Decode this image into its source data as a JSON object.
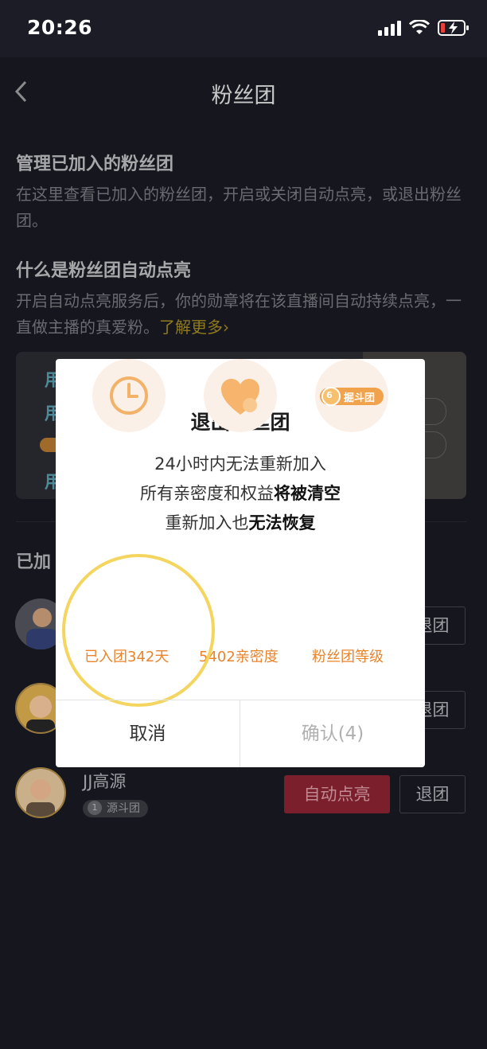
{
  "status_bar": {
    "time": "20:26"
  },
  "nav": {
    "back_icon": "chevron-left-icon",
    "title": "粉丝团"
  },
  "manage": {
    "title": "管理已加入的粉丝团",
    "body": "在这里查看已加入的粉丝团，开启或关闭自动点亮，或退出粉丝团。"
  },
  "auto_light": {
    "title": "什么是粉丝团自动点亮",
    "body": "开启自动点亮服务后，你的勋章将在该直播间自动持续点亮，一直做主播的真爱粉。",
    "link": "了解更多›"
  },
  "joined_section": {
    "title": "已加"
  },
  "rows": [
    {
      "name": "",
      "badge": "",
      "unjoin": "退团"
    },
    {
      "name": "",
      "badge": "",
      "unjoin": "退团"
    },
    {
      "name": "JJ高源",
      "badge": "源斗团",
      "auto": "自动点亮",
      "unjoin": "退团"
    }
  ],
  "dialog": {
    "title": "退出粉丝团",
    "line1": "24小时内无法重新加入",
    "line2_prefix": "所有亲密度和权益",
    "line2_bold": "将被清空",
    "line3_prefix": "重新加入也",
    "line3_bold": "无法恢复",
    "features": [
      {
        "icon": "clock-icon",
        "label": "已入团342天"
      },
      {
        "icon": "heart-icon",
        "label": "5402亲密度"
      },
      {
        "icon": "fan-badge-icon",
        "badge_level": "6",
        "badge_name": "掘斗团",
        "label": "粉丝团等级"
      }
    ],
    "cancel": "取消",
    "confirm": "确认(4)"
  },
  "colors": {
    "accent_orange": "#e8842c",
    "highlight_yellow": "#f4d55f",
    "auto_button_red": "#7a1f2b"
  }
}
